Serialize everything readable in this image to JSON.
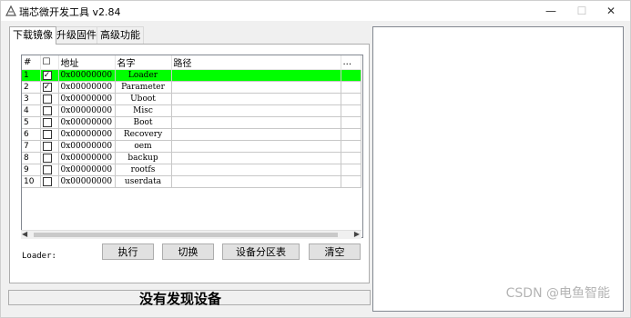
{
  "window": {
    "title": "瑞芯微开发工具 v2.84",
    "controls": {
      "minimize": "—",
      "maximize": "☐",
      "close": "✕"
    }
  },
  "tabs": [
    {
      "label": "下载镜像",
      "active": true
    },
    {
      "label": "升级固件",
      "active": false
    },
    {
      "label": "高级功能",
      "active": false
    }
  ],
  "table": {
    "headers": [
      "#",
      "☐",
      "地址",
      "名字",
      "路径",
      "..."
    ],
    "rows": [
      {
        "no": "1",
        "checked": true,
        "address": "0x00000000",
        "name": "Loader",
        "path": "",
        "selected": true
      },
      {
        "no": "2",
        "checked": true,
        "address": "0x00000000",
        "name": "Parameter",
        "path": "",
        "selected": false
      },
      {
        "no": "3",
        "checked": false,
        "address": "0x00000000",
        "name": "Uboot",
        "path": "",
        "selected": false
      },
      {
        "no": "4",
        "checked": false,
        "address": "0x00000000",
        "name": "Misc",
        "path": "",
        "selected": false
      },
      {
        "no": "5",
        "checked": false,
        "address": "0x00000000",
        "name": "Boot",
        "path": "",
        "selected": false
      },
      {
        "no": "6",
        "checked": false,
        "address": "0x00000000",
        "name": "Recovery",
        "path": "",
        "selected": false
      },
      {
        "no": "7",
        "checked": false,
        "address": "0x00000000",
        "name": "oem",
        "path": "",
        "selected": false
      },
      {
        "no": "8",
        "checked": false,
        "address": "0x00000000",
        "name": "backup",
        "path": "",
        "selected": false
      },
      {
        "no": "9",
        "checked": false,
        "address": "0x00000000",
        "name": "rootfs",
        "path": "",
        "selected": false
      },
      {
        "no": "10",
        "checked": false,
        "address": "0x00000000",
        "name": "userdata",
        "path": "",
        "selected": false
      }
    ]
  },
  "loader_label": "Loader:",
  "buttons": {
    "run": "执行",
    "switch": "切换",
    "partition": "设备分区表",
    "clear": "清空"
  },
  "status": "没有发现设备",
  "watermark": "CSDN @电鱼智能",
  "colors": {
    "selected_row": "#00ff00"
  }
}
